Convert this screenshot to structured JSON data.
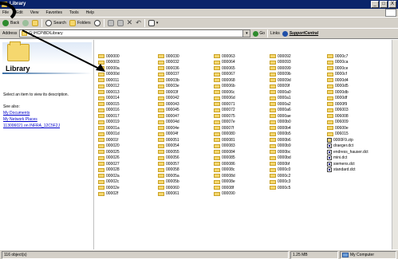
{
  "window": {
    "title": "Library",
    "min_label": "_",
    "max_label": "□",
    "close_label": "X"
  },
  "menu": [
    "File",
    "Edit",
    "View",
    "Favorites",
    "Tools",
    "Help"
  ],
  "toolbar": {
    "back_label": "Back",
    "search_label": "Search",
    "folders_label": "Folders"
  },
  "address": {
    "label": "Address",
    "value": "G:\\HCP\\BD\\Library",
    "go_label": "Go",
    "links_label": "Links",
    "support_link": "SupportCentral"
  },
  "leftpane": {
    "title": "Library",
    "description": "Select an item to view its description.",
    "see_also": "See also:",
    "links": [
      "My Documents",
      "My Network Places",
      "113006021 on INFRA_12C5F2J"
    ]
  },
  "files": {
    "col1": [
      "000000",
      "000003",
      "00000a",
      "00000d",
      "000011",
      "000012",
      "000013",
      "000014",
      "000015",
      "000016",
      "000017",
      "000019",
      "00001a",
      "00001d",
      "00001f",
      "000020",
      "000025",
      "000026",
      "000027",
      "000028",
      "00002a",
      "00002c",
      "00002e",
      "00002f"
    ],
    "col2": [
      "000030",
      "000032",
      "000036",
      "000037",
      "00003b",
      "00003e",
      "00003f",
      "000042",
      "000043",
      "000045",
      "000047",
      "00004d",
      "00004e",
      "00004f",
      "000051",
      "000054",
      "000055",
      "000056",
      "000057",
      "000058",
      "00005a",
      "00005b",
      "000060",
      "000061"
    ],
    "col3": [
      "000063",
      "000064",
      "000065",
      "000067",
      "000068",
      "00006b",
      "00006c",
      "00006d",
      "000071",
      "000072",
      "000075",
      "00007e",
      "00007f",
      "000080",
      "000081",
      "000083",
      "000084",
      "000085",
      "000086",
      "00008c",
      "00008d",
      "00008e",
      "00008f",
      "000090"
    ],
    "col4": [
      "000092",
      "000093",
      "000099",
      "00009b",
      "00009d",
      "00009f",
      "0000a0",
      "0000a1",
      "0000a2",
      "0000a6",
      "0000ae",
      "0000b0",
      "0000b4",
      "0000b5",
      "0000b6",
      "0000b9",
      "0000bc",
      "0000bd",
      "0000bf",
      "0000c0",
      "0000c2",
      "0000c3",
      "0000c5"
    ],
    "col5_folders": [
      "0000c7",
      "0000ca",
      "0000ce",
      "0000cf",
      "0000d4",
      "0000d5",
      "0000db",
      "0000df",
      "0000f9",
      "006003",
      "006008",
      "006009",
      "00600e",
      "006015"
    ],
    "col5_files": [
      {
        "name": "0000F9.zip",
        "kind": "zip"
      },
      {
        "name": "draeger.dct",
        "kind": "dct"
      },
      {
        "name": "endress_hauser.dct",
        "kind": "dct"
      },
      {
        "name": "mini.dct",
        "kind": "dct"
      },
      {
        "name": "siemens.dct",
        "kind": "dct"
      },
      {
        "name": "standard.dct",
        "kind": "dct"
      }
    ]
  },
  "status": {
    "objects": "116 object(s)",
    "size": "1.25 MB",
    "zone": "My Computer"
  },
  "colors": {
    "titlebar": "#0a246a",
    "chrome": "#d4d0c8",
    "folder": "#f5d76e",
    "link": "#0000cc"
  }
}
